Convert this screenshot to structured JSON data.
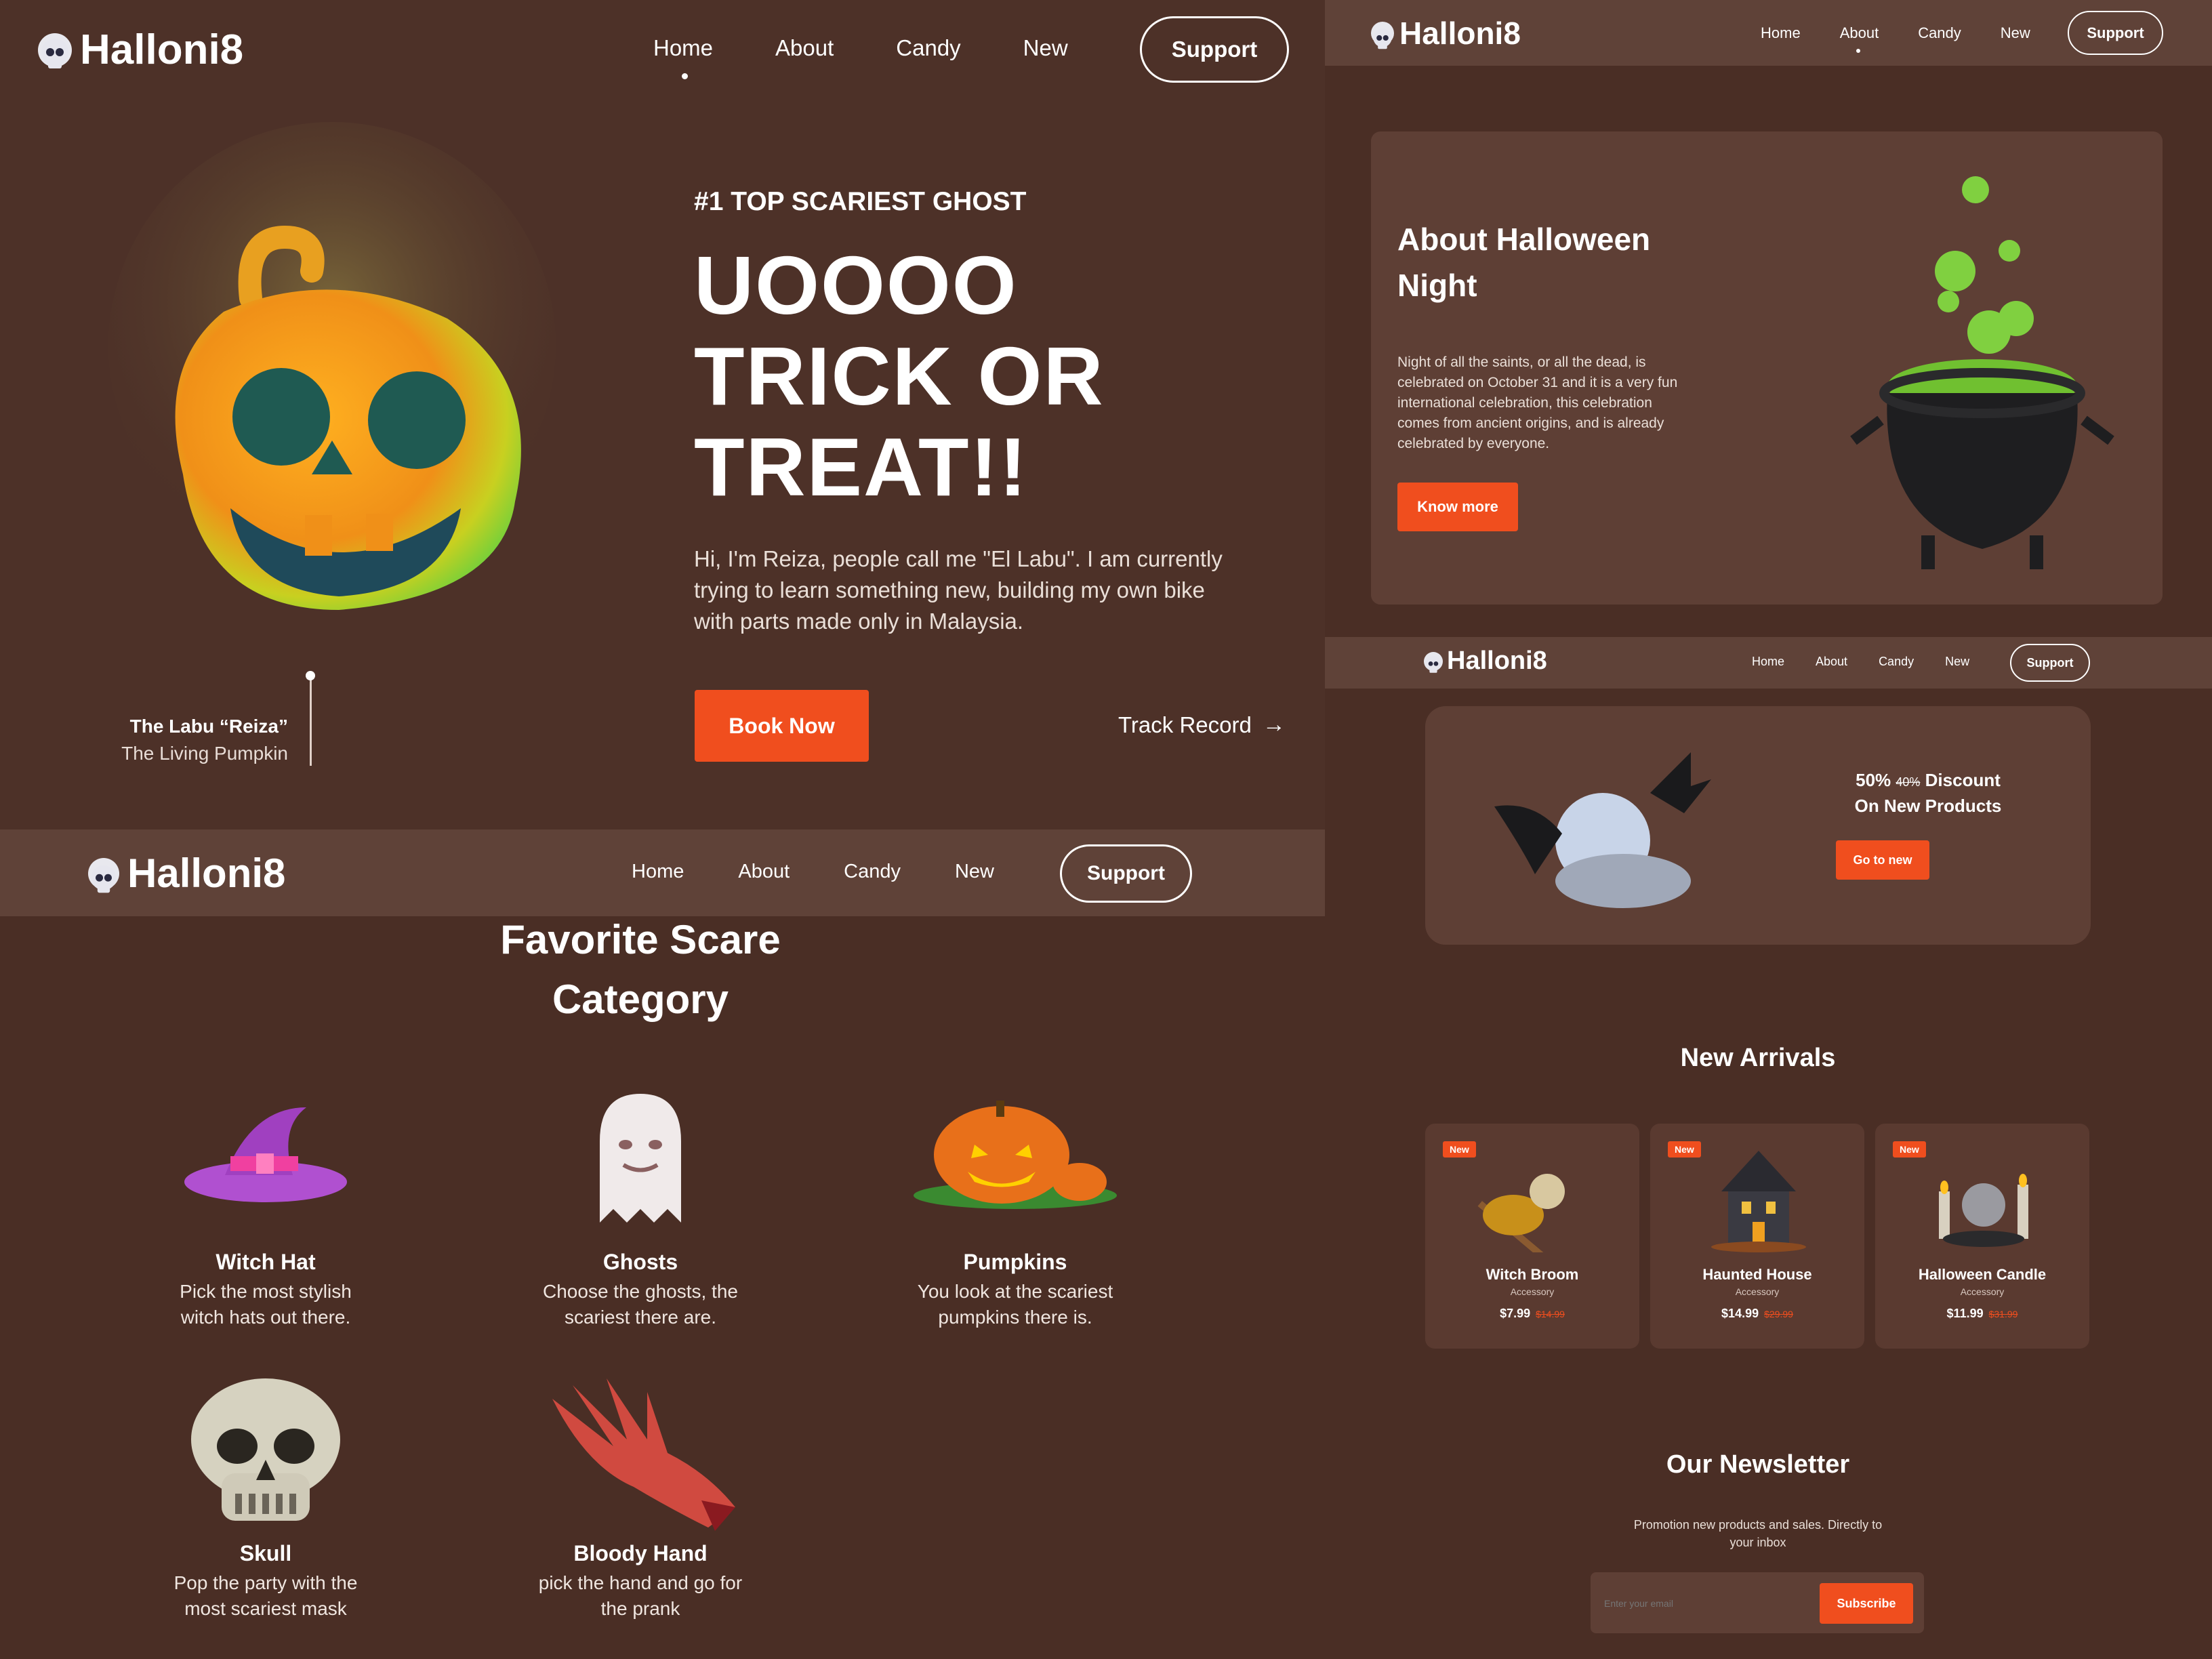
{
  "brand": {
    "name": "Halloni8"
  },
  "nav": {
    "home": "Home",
    "about": "About",
    "candy": "Candy",
    "new": "New",
    "support": "Support"
  },
  "hero": {
    "kicker": "#1 TOP SCARIEST GHOST",
    "headline_1": "UOOOO",
    "headline_2": "TRICK OR",
    "headline_3": "TREAT!!",
    "body": "Hi, I'm Reiza, people call me \"El Labu\". I am currently trying to learn something new, building my own bike with parts made only in Malaysia.",
    "book_now": "Book Now",
    "track_record": "Track Record",
    "caption_name": "The Labu “Reiza”",
    "caption_sub": "The Living Pumpkin"
  },
  "categories": {
    "title_1": "Favorite Scare",
    "title_2": "Category",
    "items": [
      {
        "title": "Witch Hat",
        "desc_1": "Pick the most stylish",
        "desc_2": "witch hats out there."
      },
      {
        "title": "Ghosts",
        "desc_1": "Choose the ghosts, the",
        "desc_2": "scariest there are."
      },
      {
        "title": "Pumpkins",
        "desc_1": "You look at the scariest",
        "desc_2": "pumpkins there is."
      },
      {
        "title": "Skull",
        "desc_1": "Pop the party with the",
        "desc_2": "most scariest mask"
      },
      {
        "title": "Bloody Hand",
        "desc_1": "pick the hand and go for",
        "desc_2": "the prank"
      }
    ]
  },
  "about": {
    "title_1": "About Halloween",
    "title_2": "Night",
    "body": "Night of all the saints, or all the dead, is celebrated on October 31 and it is a very fun international celebration, this celebration comes from ancient origins, and is already celebrated by everyone.",
    "cta": "Know more"
  },
  "promo": {
    "line_1_prefix": "50%",
    "line_1_strike": "40%",
    "line_1_suffix": "Discount",
    "line_2": "On New Products",
    "cta": "Go to new"
  },
  "arrivals": {
    "title": "New Arrivals",
    "products": [
      {
        "badge": "New",
        "name": "Witch Broom",
        "type": "Accessory",
        "price": "$7.99",
        "old_price": "$14.99"
      },
      {
        "badge": "New",
        "name": "Haunted House",
        "type": "Accessory",
        "price": "$14.99",
        "old_price": "$29.99"
      },
      {
        "badge": "New",
        "name": "Halloween Candle",
        "type": "Accessory",
        "price": "$11.99",
        "old_price": "$31.99"
      }
    ]
  },
  "newsletter": {
    "title": "Our Newsletter",
    "desc_1": "Promotion new products and sales. Directly to",
    "desc_2": "your inbox",
    "placeholder": "Enter your email",
    "cta": "Subscribe"
  },
  "colors": {
    "accent": "#f04e1e",
    "background": "#4a2e25",
    "card": "#5a3a30"
  }
}
